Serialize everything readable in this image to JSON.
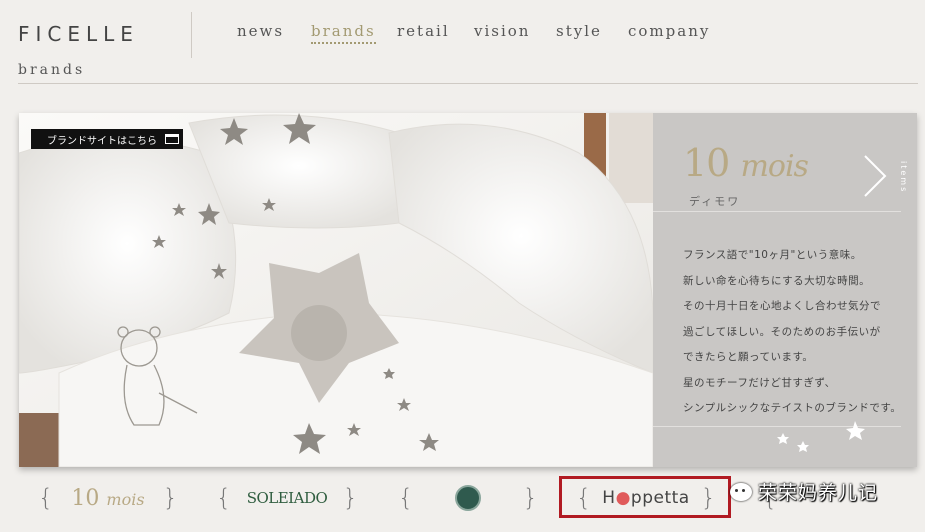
{
  "header": {
    "logo": "FICELLE",
    "section_title": "brands",
    "nav": [
      {
        "label": "news",
        "active": false
      },
      {
        "label": "brands",
        "active": true
      },
      {
        "label": "retail",
        "active": false
      },
      {
        "label": "vision",
        "active": false
      },
      {
        "label": "style",
        "active": false
      },
      {
        "label": "company",
        "active": false
      }
    ]
  },
  "hero": {
    "site_link_label": "ブランドサイトはこちら",
    "site_link_icon": "window-icon",
    "brand_name": "10",
    "brand_name_suffix": "mois",
    "brand_kana": "ディモワ",
    "next_icon": "chevron-right-icon",
    "items_label": "items",
    "description": "フランス語で\"10ヶ月\"という意味。\n新しい命を心待ちにする大切な時間。\nその十月十日を心地よくし合わせ気分で\n過ごしてほしい。そのためのお手伝いが\nできたらと願っています。\n星のモチーフだけど甘すぎず、\nシンプルシックなテイストのブランドです。"
  },
  "brand_strip": {
    "items": [
      {
        "name": "10",
        "suffix": "mois"
      },
      {
        "name": "SOLEIADO"
      },
      {
        "name": "",
        "icon": "circle-emblem-icon"
      },
      {
        "name_prefix": "H",
        "name_dot": "●",
        "name_rest": "ppetta",
        "highlighted": true
      },
      {
        "name": ""
      }
    ],
    "highlight_color": "#b11a22"
  },
  "watermark": {
    "text": "荣荣妈养儿记",
    "icon": "wechat-icon"
  },
  "colors": {
    "background": "#f1efec",
    "brand_gold": "#b8a985",
    "panel": "#c9c7c5",
    "active_nav": "#a39a72"
  }
}
